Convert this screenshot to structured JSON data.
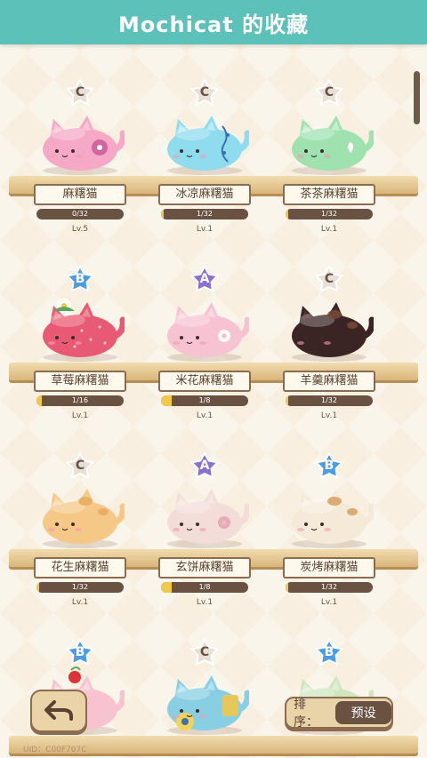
{
  "header": {
    "title": "Mochicat 的收藏"
  },
  "rows": [
    [
      {
        "rank": "C",
        "name": "麻糬猫",
        "progress": "0/32",
        "fill": 0.0,
        "level": "Lv.5",
        "body": "#f6a9c6",
        "mark": "#c95a96",
        "ear": "#f8c5d8",
        "deco": "flower"
      },
      {
        "rank": "C",
        "name": "冰凉麻糬猫",
        "progress": "1/32",
        "fill": 0.03,
        "level": "Lv.1",
        "body": "#8fdcef",
        "mark": "#3e6fb5",
        "ear": "#b9ecf6",
        "deco": "vine"
      },
      {
        "rank": "C",
        "name": "茶茶麻糬猫",
        "progress": "1/32",
        "fill": 0.03,
        "level": "Lv.1",
        "body": "#9fe2b0",
        "mark": "#ffffff",
        "ear": "#c4efcf",
        "deco": "sprout"
      }
    ],
    [
      {
        "rank": "B",
        "name": "草莓麻糬猫",
        "progress": "1/16",
        "fill": 0.06,
        "level": "Lv.1",
        "body": "#e85a73",
        "mark": "#ffd0d8",
        "ear": "#f08a9c",
        "deco": "strawberry"
      },
      {
        "rank": "A",
        "name": "米花麻糬猫",
        "progress": "1/8",
        "fill": 0.125,
        "level": "Lv.1",
        "body": "#f6c3d3",
        "mark": "#ffffff",
        "ear": "#f9d7e2",
        "deco": "blossom"
      },
      {
        "rank": "C",
        "name": "羊羹麻糬猫",
        "progress": "1/32",
        "fill": 0.03,
        "level": "Lv.1",
        "body": "#3a2424",
        "mark": "#7a4b36",
        "ear": "#523232",
        "deco": "spots"
      }
    ],
    [
      {
        "rank": "C",
        "name": "花生麻糬猫",
        "progress": "1/32",
        "fill": 0.03,
        "level": "Lv.1",
        "body": "#f5c887",
        "mark": "#e6a757",
        "ear": "#f9d9a8",
        "deco": "spots"
      },
      {
        "rank": "A",
        "name": "玄饼麻糬猫",
        "progress": "1/8",
        "fill": 0.125,
        "level": "Lv.1",
        "body": "#f3ddd8",
        "mark": "#e7a6b2",
        "ear": "#f6e6e2",
        "deco": "blossom"
      },
      {
        "rank": "B",
        "name": "炭烤麻糬猫",
        "progress": "1/32",
        "fill": 0.03,
        "level": "Lv.1",
        "body": "#f4ead7",
        "mark": "#d49a58",
        "ear": "#f9f1e2",
        "deco": "spots"
      }
    ],
    [
      {
        "rank": "B",
        "name": "",
        "progress": "",
        "fill": 0.0,
        "level": "",
        "body": "#f7c3cf",
        "mark": "#ffffff",
        "ear": "#f9d7df",
        "deco": "cherry"
      },
      {
        "rank": "C",
        "name": "",
        "progress": "",
        "fill": 0.0,
        "level": "",
        "body": "#88cfe4",
        "mark": "#3e6fb5",
        "ear": "#b0e2ef",
        "deco": "gear"
      },
      {
        "rank": "B",
        "name": "",
        "progress": "",
        "fill": 0.0,
        "level": "",
        "body": "#cfe7c1",
        "mark": "#ffffff",
        "ear": "#def0d4",
        "deco": "none"
      }
    ]
  ],
  "rank_colors": {
    "A": "#8b6fd2",
    "B": "#4b9be6",
    "C": "#e6e0d6"
  },
  "controls": {
    "back_icon": "back-arrow-icon",
    "sort_label": "排序：",
    "sort_value": "预设"
  },
  "footer": {
    "uid": "UID：C00F707C"
  }
}
